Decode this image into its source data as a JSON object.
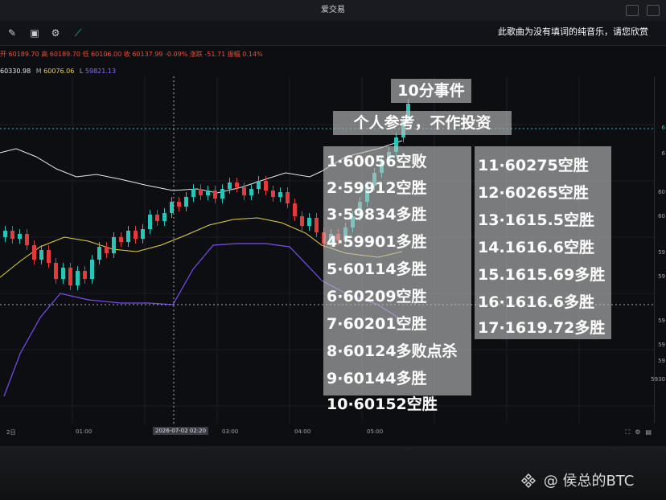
{
  "window": {
    "title": "爱交易"
  },
  "toolbar": {
    "icons": [
      "pen-tool-icon",
      "screenshot-icon",
      "layers-icon",
      "settings-icon",
      "draw-line-icon"
    ],
    "song_notice": "此歌曲为没有填词的纯音乐，请您欣赏"
  },
  "info_line": {
    "text": "开 60189.70 高 60189.70 低 60106.00 收 60137.99 -0.09% 涨跌 -51.71 振幅 0.14%"
  },
  "ma_line": {
    "up": "60330.98",
    "m_label": "M",
    "m_value": "60076.06",
    "l_label": "L",
    "l_value": "59821.13"
  },
  "price_axis": {
    "ticks": [
      "6",
      "6",
      "60",
      "60",
      "59",
      "59",
      "59",
      "59",
      "59",
      "5930"
    ]
  },
  "time_axis": {
    "labels": [
      "2日",
      "01:00",
      "03:00",
      "04:00",
      "05:00"
    ],
    "cursor_label": "2026-07-02  02:20"
  },
  "overlay": {
    "title": "10分事件",
    "subtitle": "个人参考，不作投资",
    "list_left": [
      "1·60056空败",
      "2·59912空胜",
      "3·59834多胜",
      "4·59901多胜",
      "5·60114多胜",
      "6·60209空胜",
      "7·60201空胜",
      "8·60124多败点杀",
      "9·60144多胜",
      "10·60152空胜"
    ],
    "list_right": [
      "11·60275空胜",
      "12·60265空胜",
      "13·1615.5空胜",
      "14.1616.6空胜",
      "15.1615.69多胜",
      "16·1616.6多胜",
      "17·1619.72多胜"
    ]
  },
  "watermark": {
    "text": "@ 侯总的BTC"
  },
  "colors": {
    "up": "#26c6b8",
    "down": "#e23b3b",
    "bb": "#e8e8e8",
    "ma_yellow": "#e7d23a",
    "ma_purple": "#7a4df0",
    "info_red": "#e8503a"
  }
}
